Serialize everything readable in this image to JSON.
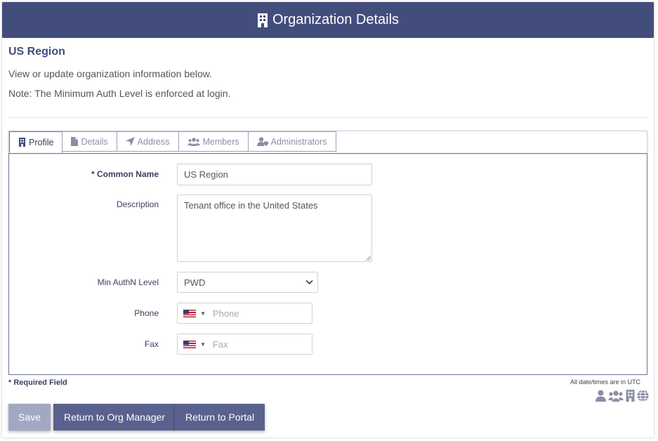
{
  "header": {
    "title": "Organization Details",
    "icon": "building-icon"
  },
  "org": {
    "name": "US Region"
  },
  "intro": "View or update organization information below.",
  "note": "Note: The Minimum Auth Level is enforced at login.",
  "tabs": [
    {
      "label": "Profile",
      "icon": "building-icon",
      "active": true
    },
    {
      "label": "Details",
      "icon": "file-icon",
      "active": false
    },
    {
      "label": "Address",
      "icon": "location-arrow-icon",
      "active": false
    },
    {
      "label": "Members",
      "icon": "users-icon",
      "active": false
    },
    {
      "label": "Administrators",
      "icon": "user-shield-icon",
      "active": false
    }
  ],
  "form": {
    "common_name": {
      "label": "* Common Name",
      "value": "US Region"
    },
    "description": {
      "label": "Description",
      "value": "Tenant office in the United States"
    },
    "min_authn": {
      "label": "Min AuthN Level",
      "value": "PWD"
    },
    "phone": {
      "label": "Phone",
      "placeholder": "Phone"
    },
    "fax": {
      "label": "Fax",
      "placeholder": "Fax"
    }
  },
  "footer": {
    "required_note": "* Required Field",
    "utc_note": "All date/times are in UTC",
    "icons": [
      "user-icon",
      "users-icon",
      "building-icon",
      "globe-icon"
    ]
  },
  "buttons": {
    "save": "Save",
    "org_manager": "Return to Org Manager",
    "portal": "Return to Portal"
  },
  "colors": {
    "header": "#434d7c",
    "button": "#5a618e",
    "button_disabled": "#a3a8c2"
  }
}
